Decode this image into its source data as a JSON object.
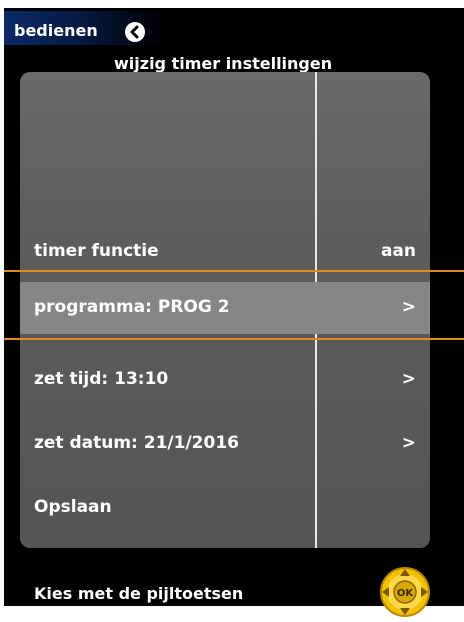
{
  "header": {
    "tab_label": "bedienen",
    "back_icon": "chevron-left-icon",
    "title": "wijzig timer instellingen"
  },
  "menu": {
    "rows": [
      {
        "label": "timer functie",
        "value": "aan",
        "selected": false
      },
      {
        "label": "programma: PROG 2",
        "value": ">",
        "selected": true
      },
      {
        "label": "zet tijd: 13:10",
        "value": ">",
        "selected": false
      },
      {
        "label": "zet datum: 21/1/2016",
        "value": ">",
        "selected": false
      },
      {
        "label": "Opslaan",
        "value": "",
        "selected": false
      }
    ]
  },
  "footer": {
    "hint": "Kies met de pijltoetsen",
    "nav_icon": "dpad-ok-icon",
    "nav_label": "OK"
  },
  "colors": {
    "background": "#000000",
    "panel": "#5d5d5d",
    "selected_row": "#868686",
    "accent": "#e08a1a",
    "nav_icon": "#f2c100"
  }
}
